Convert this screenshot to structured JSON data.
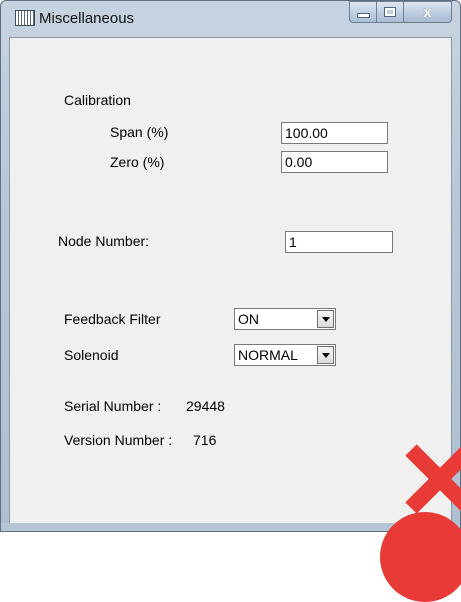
{
  "window": {
    "title": "Miscellaneous"
  },
  "caption": {
    "minimize": "minimize",
    "maximize": "maximize",
    "close": "x"
  },
  "calibration": {
    "heading": "Calibration",
    "span_label": "Span (%)",
    "span_value": "100.00",
    "zero_label": "Zero (%)",
    "zero_value": "0.00"
  },
  "node": {
    "label": "Node Number:",
    "value": "1"
  },
  "feedback_filter": {
    "label": "Feedback Filter",
    "selected": "ON"
  },
  "solenoid": {
    "label": "Solenoid",
    "selected": "NORMAL"
  },
  "serial": {
    "label": "Serial Number :",
    "value": "29448"
  },
  "version": {
    "label": "Version Number :",
    "value": "716"
  },
  "overlay_color": "#e83a36"
}
